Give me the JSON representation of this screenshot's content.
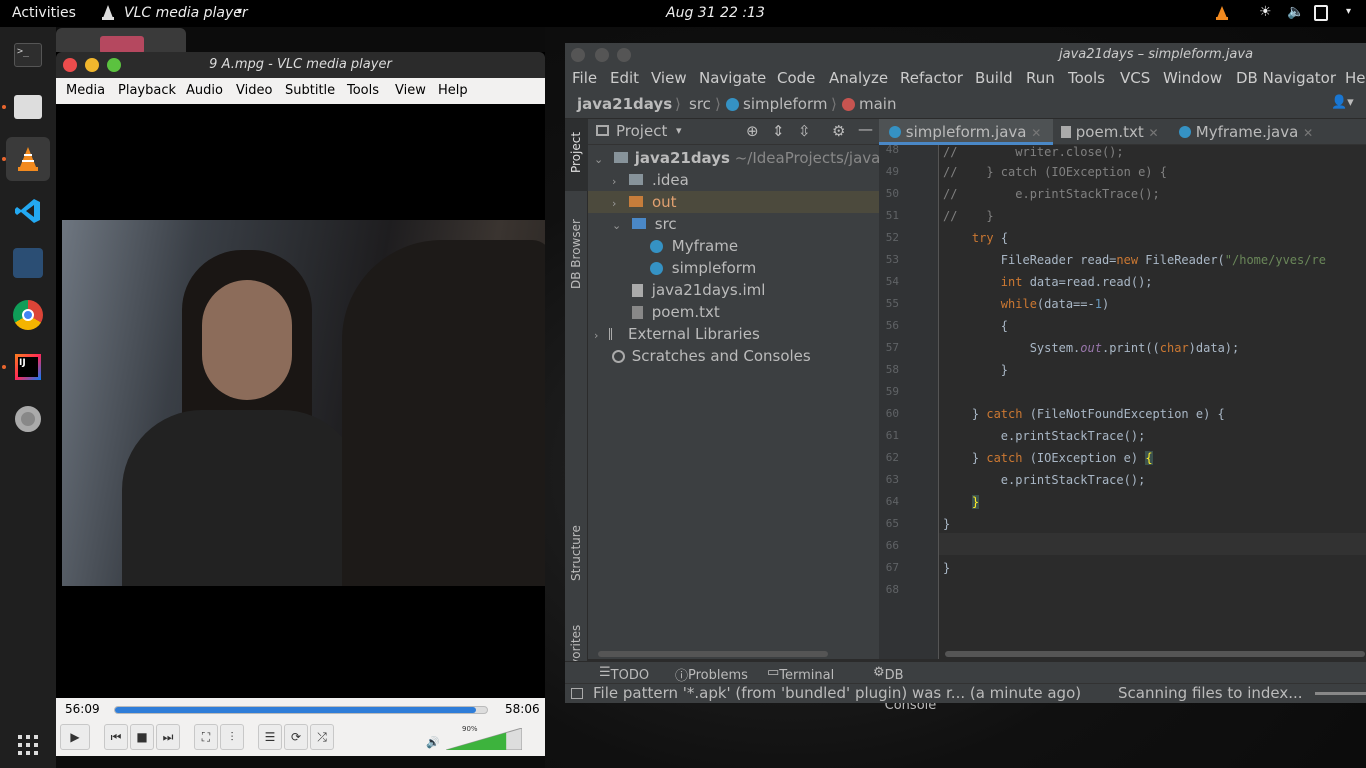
{
  "topbar": {
    "activities": "Activities",
    "app_name": "VLC media player",
    "clock": "Aug 31  22 :13"
  },
  "vlc": {
    "title": "9 A.mpg - VLC media player",
    "menu": [
      "Media",
      "Playback",
      "Audio",
      "Video",
      "Subtitle",
      "Tools",
      "View",
      "Help"
    ],
    "elapsed": "56:09",
    "total": "58:06",
    "progress": 0.97,
    "volume_label": "90%",
    "volume": 0.9
  },
  "ij": {
    "title": "java21days – simpleform.java",
    "menu": [
      "File",
      "Edit",
      "View",
      "Navigate",
      "Code",
      "Analyze",
      "Refactor",
      "Build",
      "Run",
      "Tools",
      "VCS",
      "Window",
      "DB Navigator",
      "He"
    ],
    "breadcrumb": [
      "java21days",
      "src",
      "simpleform",
      "main"
    ],
    "left_strip": [
      "Project",
      "DB Browser",
      "Structure",
      "Favorites"
    ],
    "project_header": "Project",
    "tree": [
      {
        "label": "java21days",
        "extra": "~/IdeaProjects/java"
      },
      {
        "label": ".idea"
      },
      {
        "label": "out"
      },
      {
        "label": "src"
      },
      {
        "label": "Myframe"
      },
      {
        "label": "simpleform"
      },
      {
        "label": "java21days.iml"
      },
      {
        "label": "poem.txt"
      },
      {
        "label": "External Libraries"
      },
      {
        "label": "Scratches and Consoles"
      }
    ],
    "tabs": [
      "simpleform.java",
      "poem.txt",
      "Myframe.java"
    ],
    "line_numbers": [
      "48",
      "49",
      "50",
      "51",
      "52",
      "53",
      "54",
      "55",
      "56",
      "57",
      "58",
      "59",
      "60",
      "61",
      "62",
      "63",
      "64",
      "65",
      "66",
      "67",
      "68"
    ],
    "bottom_tabs": [
      "TODO",
      "Problems",
      "Terminal",
      "DB Execution Console"
    ],
    "status_left": "File pattern '*.apk' (from 'bundled' plugin) was r... (a minute ago)",
    "status_right": "Scanning files to index..."
  },
  "colors": {
    "vlc_orange": "#f28a1f",
    "ij_bg": "#2b2b2b",
    "ij_panel": "#3c3f41",
    "keyword": "#cc7832",
    "string": "#6a8759"
  }
}
